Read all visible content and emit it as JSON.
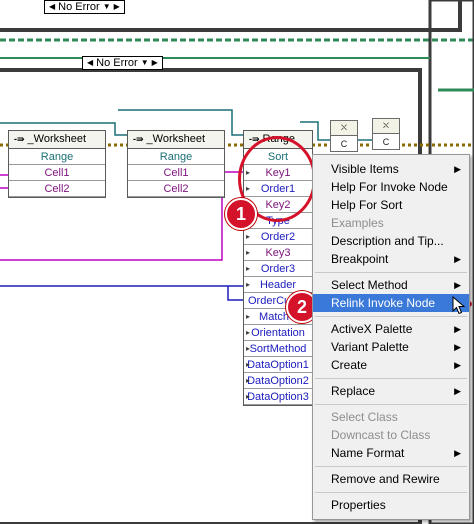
{
  "case_selectors": [
    {
      "label": "No Error"
    },
    {
      "label": "No Error"
    }
  ],
  "worksheet_nodes": [
    {
      "title": "_Worksheet",
      "rows": [
        "Range",
        "Cell1",
        "Cell2"
      ]
    },
    {
      "title": "_Worksheet",
      "rows": [
        "Range",
        "Cell1",
        "Cell2"
      ]
    }
  ],
  "range_node": {
    "title": "Range",
    "rows": [
      "Sort",
      "Key1",
      "Order1",
      "Key2",
      "Type",
      "Order2",
      "Key3",
      "Order3",
      "Header",
      "OrderCu",
      "MatchC",
      "Orientation",
      "SortMethod",
      "DataOption1",
      "DataOption2",
      "DataOption3"
    ]
  },
  "mini_nodes": [
    {
      "label": "C"
    },
    {
      "label": "C"
    }
  ],
  "badges": [
    "1",
    "2"
  ],
  "context_menu": {
    "items": [
      {
        "label": "Visible Items",
        "submenu": true,
        "disabled": false
      },
      {
        "label": "Help For Invoke Node",
        "submenu": false,
        "disabled": false
      },
      {
        "label": "Help For Sort",
        "submenu": false,
        "disabled": false
      },
      {
        "label": "Examples",
        "submenu": false,
        "disabled": true
      },
      {
        "label": "Description and Tip...",
        "submenu": false,
        "disabled": false
      },
      {
        "label": "Breakpoint",
        "submenu": true,
        "disabled": false
      },
      {
        "sep": true
      },
      {
        "label": "Select Method",
        "submenu": true,
        "disabled": false
      },
      {
        "label": "Relink Invoke Node",
        "submenu": false,
        "disabled": false,
        "selected": true
      },
      {
        "sep": true
      },
      {
        "label": "ActiveX Palette",
        "submenu": true,
        "disabled": false
      },
      {
        "label": "Variant Palette",
        "submenu": true,
        "disabled": false
      },
      {
        "label": "Create",
        "submenu": true,
        "disabled": false
      },
      {
        "sep": true
      },
      {
        "label": "Replace",
        "submenu": true,
        "disabled": false
      },
      {
        "sep": true
      },
      {
        "label": "Select Class",
        "submenu": false,
        "disabled": true
      },
      {
        "label": "Downcast to Class",
        "submenu": false,
        "disabled": true
      },
      {
        "label": "Name Format",
        "submenu": true,
        "disabled": false
      },
      {
        "sep": true
      },
      {
        "label": "Remove and Rewire",
        "submenu": false,
        "disabled": false
      },
      {
        "sep": true
      },
      {
        "label": "Properties",
        "submenu": false,
        "disabled": false
      }
    ]
  },
  "colors": {
    "highlight": "#d4122a",
    "menu_selected": "#3a79d8",
    "wire_teal": "#1a6f76",
    "wire_purple": "#c000c0",
    "wire_blue": "#1b1bbf",
    "frame_green": "#2e7d32",
    "error_wire": "#8a6a00"
  }
}
